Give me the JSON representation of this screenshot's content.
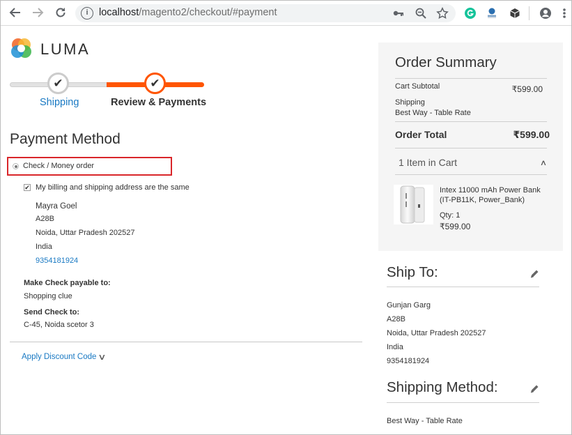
{
  "browser": {
    "url_host": "localhost",
    "url_path": "/magento2/checkout/#payment",
    "icons": {
      "back": "back-arrow-icon",
      "forward": "forward-arrow-icon",
      "reload": "reload-icon",
      "info": "info-icon",
      "key": "key-icon",
      "zoom": "zoom-icon",
      "star": "bookmark-star-icon",
      "grammarly": "grammarly-icon",
      "extension": "extension-icon",
      "package": "package-icon",
      "account": "account-icon",
      "menu": "menu-icon"
    },
    "info_glyph": "i"
  },
  "logo": {
    "text": "LUMA"
  },
  "progress": {
    "steps": [
      {
        "label": "Shipping",
        "status": "complete"
      },
      {
        "label": "Review & Payments",
        "status": "active"
      }
    ],
    "check_glyph": "✔",
    "accent_color": "#ff5501"
  },
  "payment": {
    "title": "Payment Method",
    "option_label": "Check / Money order",
    "same_address_label": "My billing and shipping address are the same",
    "billing_address": {
      "name": "Mayra Goel",
      "street": "A28B",
      "city_line": "Noida, Uttar Pradesh 202527",
      "country": "India",
      "phone": "9354181924"
    },
    "payable_to_label": "Make Check payable to:",
    "payable_to_value": "Shopping clue",
    "send_to_label": "Send Check to:",
    "send_to_value": "C-45, Noida scetor 3",
    "discount_label": "Apply Discount Code",
    "chevron": "∨",
    "checkbox_glyph": "✔"
  },
  "summary": {
    "title": "Order Summary",
    "subtotal_label": "Cart Subtotal",
    "subtotal_value": "₹599.00",
    "shipping_label": "Shipping",
    "shipping_method": "Best Way - Table Rate",
    "total_label": "Order Total",
    "total_value": "₹599.00",
    "items_label": "1 Item in Cart",
    "up_chevron": "∧",
    "product": {
      "name": "Intex 11000 mAh Power Bank (IT-PB11K, Power_Bank)",
      "qty": "Qty: 1",
      "price": "₹599.00"
    }
  },
  "ship_to": {
    "title": "Ship To:",
    "name": "Gunjan Garg",
    "street": "A28B",
    "city_line": "Noida, Uttar Pradesh 202527",
    "country": "India",
    "phone": "9354181924"
  },
  "shipping_method": {
    "title": "Shipping Method:",
    "value": "Best Way - Table Rate"
  },
  "colors": {
    "link": "#1979c3",
    "highlight_box": "#d9262a",
    "summary_bg": "#f5f5f5"
  }
}
